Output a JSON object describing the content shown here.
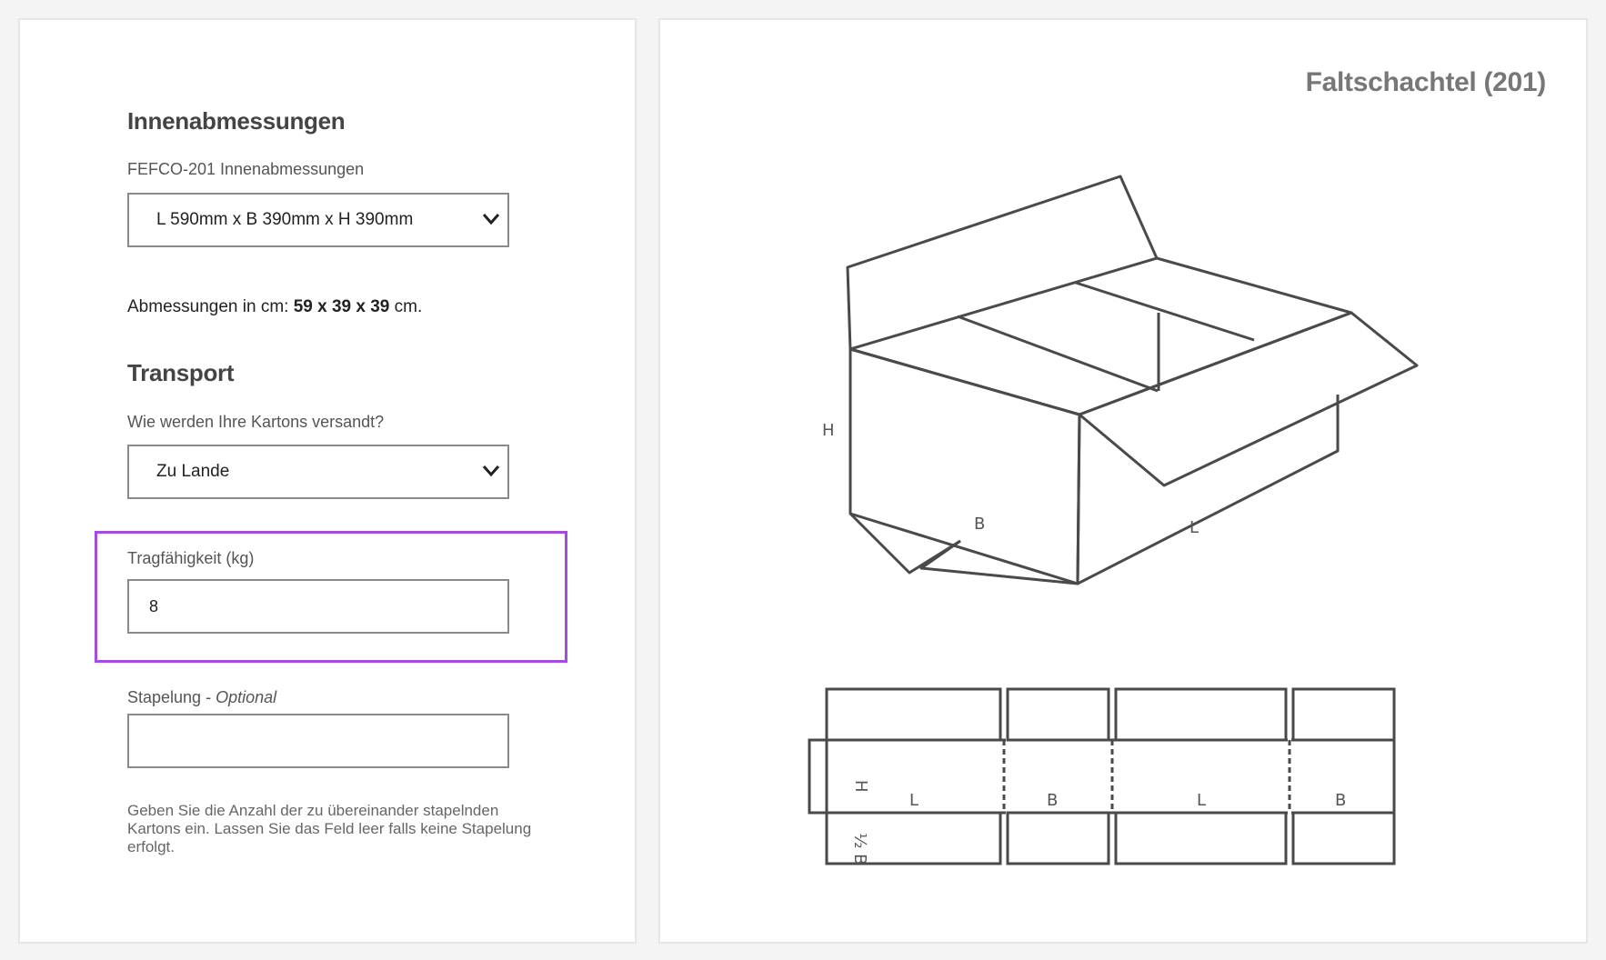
{
  "left": {
    "inner_dims_heading": "Innenabmessungen",
    "inner_dims_label": "FEFCO-201 Innenabmessungen",
    "inner_dims_value": "L 590mm x B 390mm x H 390mm",
    "dims_prefix": "Abmessungen in cm: ",
    "dims_value": "59 x 39 x 39",
    "dims_suffix": " cm.",
    "transport_heading": "Transport",
    "transport_label": "Wie werden Ihre Kartons versandt?",
    "transport_value": "Zu Lande",
    "capacity_label": "Tragfähigkeit (kg)",
    "capacity_value": "8",
    "stacking_label": "Stapelung - ",
    "stacking_optional": "Optional",
    "stacking_value": "",
    "stacking_help": "Geben Sie die Anzahl der zu übereinander stapelnden Kartons ein. Lassen Sie das Feld leer falls keine Stapelung erfolgt."
  },
  "right": {
    "title": "Faltschachtel (201)",
    "box_labels": {
      "h": "H",
      "b": "B",
      "l": "L"
    },
    "net_labels": {
      "h": "H",
      "l1": "L",
      "b1": "B",
      "l2": "L",
      "b2": "B",
      "half_b": "½ B"
    }
  },
  "colors": {
    "highlight": "#a64be0",
    "drawing_stroke": "#4a4a4a"
  }
}
